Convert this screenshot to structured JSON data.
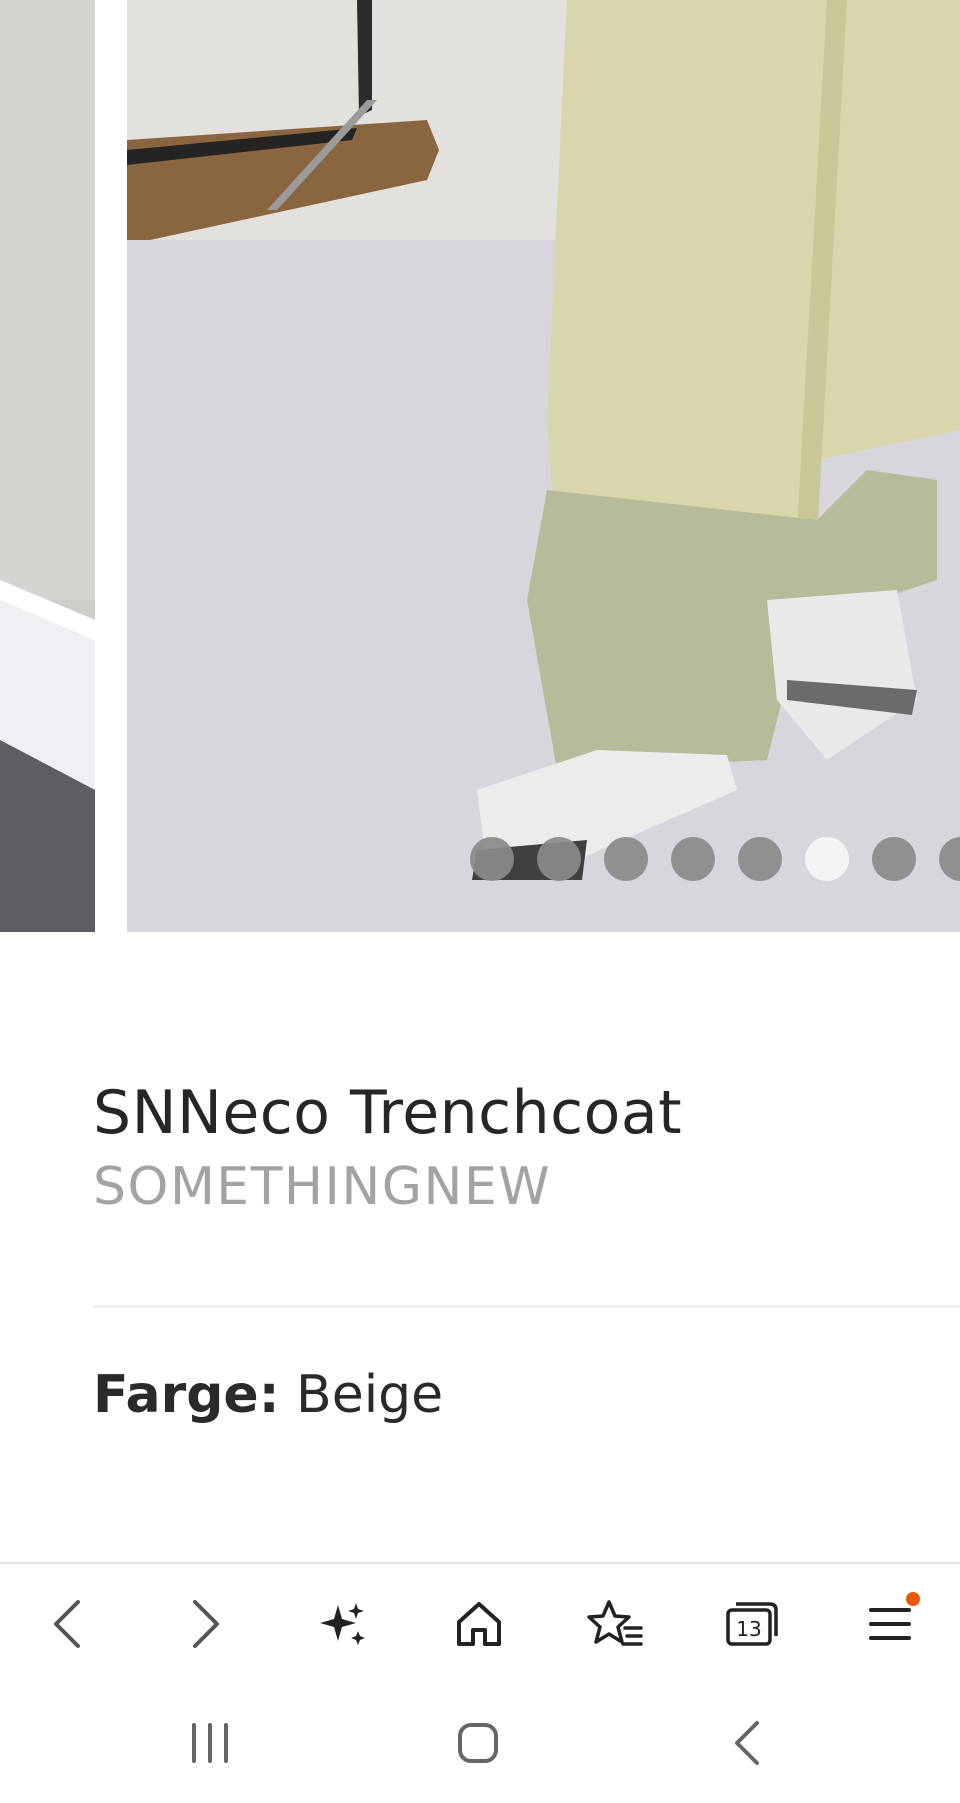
{
  "carousel": {
    "dot_count": 8,
    "active_index": 5
  },
  "product": {
    "title": "SNNeco Trenchcoat",
    "brand": "SOMETHINGNEW",
    "color_label": "Farge:",
    "color_value": "Beige"
  },
  "toolbar": {
    "tabs_count": "13",
    "notification_color": "#e8590c",
    "items": [
      "back-icon",
      "forward-icon",
      "ai-sparkle-icon",
      "home-icon",
      "bookmarks-icon",
      "tabs-icon",
      "menu-icon"
    ]
  },
  "system_nav": {
    "items": [
      "recent-apps-icon",
      "home-circle-icon",
      "system-back-icon"
    ]
  }
}
